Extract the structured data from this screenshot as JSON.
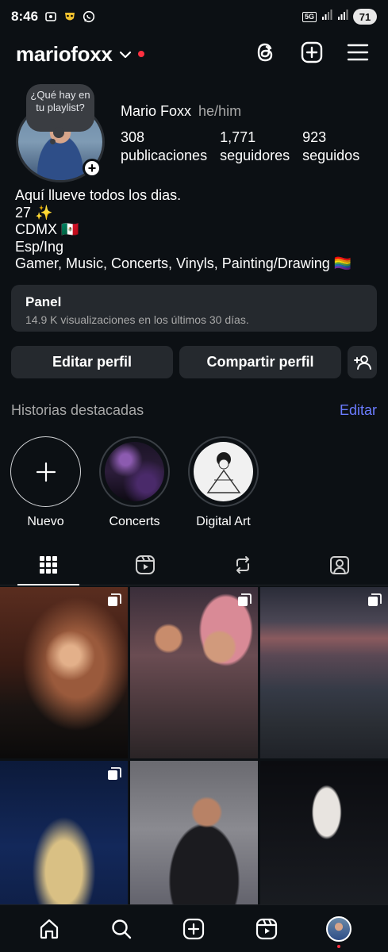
{
  "status_bar": {
    "time": "8:46",
    "network": "5G",
    "battery": "71"
  },
  "header": {
    "username": "mariofoxx"
  },
  "profile": {
    "note": "¿Qué hay en tu playlist?",
    "name": "Mario Foxx",
    "pronouns": "he/him",
    "stats": [
      {
        "value": "308",
        "label": "publicaciones"
      },
      {
        "value": "1,771",
        "label": "seguidores"
      },
      {
        "value": "923",
        "label": "seguidos"
      }
    ],
    "bio": [
      "Aquí llueve todos los dias.",
      "27 ✨",
      "CDMX 🇲🇽",
      "Esp/Ing",
      "Gamer, Music, Concerts, Vinyls, Painting/Drawing 🏳️‍🌈"
    ]
  },
  "panel": {
    "title": "Panel",
    "subtitle": "14.9 K visualizaciones en los últimos 30 días."
  },
  "buttons": {
    "edit": "Editar perfil",
    "share": "Compartir perfil"
  },
  "highlights": {
    "title": "Historias destacadas",
    "edit": "Editar",
    "items": [
      {
        "label": "Nuevo"
      },
      {
        "label": "Concerts"
      },
      {
        "label": "Digital Art"
      }
    ]
  },
  "tabs": [
    {
      "icon": "grid-icon",
      "active": true
    },
    {
      "icon": "reels-icon",
      "active": false
    },
    {
      "icon": "reposts-icon",
      "active": false
    },
    {
      "icon": "tagged-icon",
      "active": false
    }
  ],
  "accent_colors": {
    "link": "#6b7cff",
    "notification": "#ff3040",
    "surface": "#25292e",
    "background": "#0c1014"
  }
}
